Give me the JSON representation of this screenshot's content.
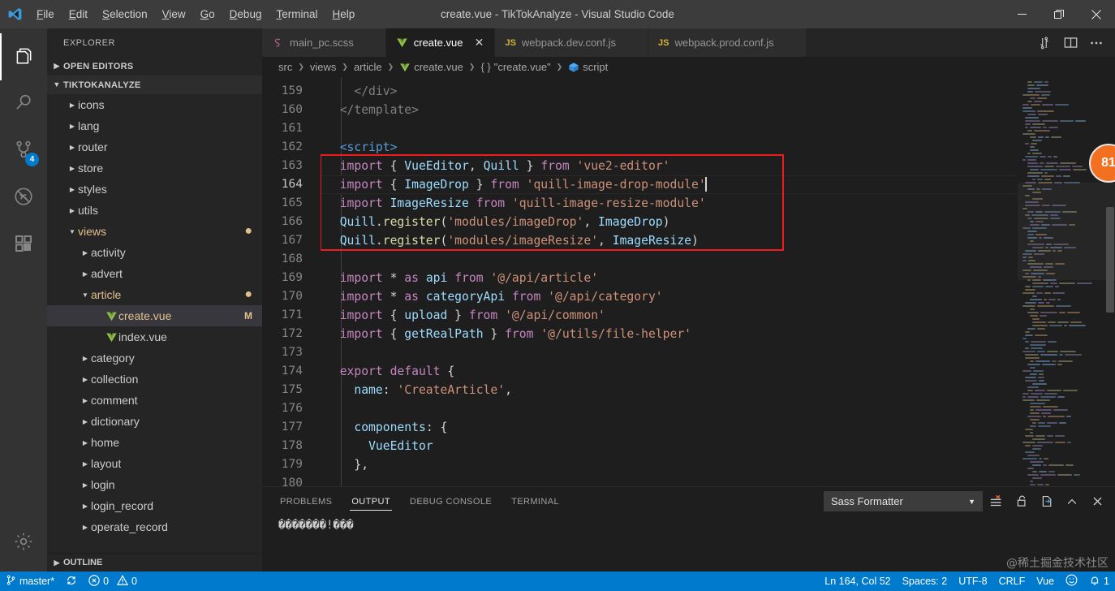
{
  "window": {
    "title": "create.vue - TikTokAnalyze - Visual Studio Code",
    "minimize": "–",
    "maximize": "❐",
    "close": "✕"
  },
  "menubar": {
    "items": [
      {
        "label": "File"
      },
      {
        "label": "Edit"
      },
      {
        "label": "Selection"
      },
      {
        "label": "View"
      },
      {
        "label": "Go"
      },
      {
        "label": "Debug"
      },
      {
        "label": "Terminal"
      },
      {
        "label": "Help"
      }
    ]
  },
  "activitybar": {
    "items": [
      {
        "name": "explorer",
        "icon": "files-icon",
        "badge": ""
      },
      {
        "name": "search",
        "icon": "search-icon",
        "badge": ""
      },
      {
        "name": "source-control",
        "icon": "source-control-icon",
        "badge": "4"
      },
      {
        "name": "debug",
        "icon": "debug-icon",
        "badge": ""
      },
      {
        "name": "extensions",
        "icon": "extensions-icon",
        "badge": ""
      }
    ],
    "settings_icon": "gear-icon"
  },
  "sidebar": {
    "title": "EXPLORER",
    "open_editors": "OPEN EDITORS",
    "project": "TIKTOKANALYZE",
    "outline": "OUTLINE",
    "tree": [
      {
        "label": "icons",
        "indent": 1,
        "type": "folder",
        "state": "collapsed"
      },
      {
        "label": "lang",
        "indent": 1,
        "type": "folder",
        "state": "collapsed"
      },
      {
        "label": "router",
        "indent": 1,
        "type": "folder",
        "state": "collapsed"
      },
      {
        "label": "store",
        "indent": 1,
        "type": "folder",
        "state": "collapsed"
      },
      {
        "label": "styles",
        "indent": 1,
        "type": "folder",
        "state": "collapsed"
      },
      {
        "label": "utils",
        "indent": 1,
        "type": "folder",
        "state": "collapsed"
      },
      {
        "label": "views",
        "indent": 1,
        "type": "folder",
        "state": "expanded",
        "modified": true
      },
      {
        "label": "activity",
        "indent": 2,
        "type": "folder",
        "state": "collapsed"
      },
      {
        "label": "advert",
        "indent": 2,
        "type": "folder",
        "state": "collapsed"
      },
      {
        "label": "article",
        "indent": 2,
        "type": "folder",
        "state": "expanded",
        "modified": true
      },
      {
        "label": "create.vue",
        "indent": 3,
        "type": "vue",
        "state": "none",
        "selected": true,
        "modified": true,
        "badge": "M"
      },
      {
        "label": "index.vue",
        "indent": 3,
        "type": "vue",
        "state": "none"
      },
      {
        "label": "category",
        "indent": 2,
        "type": "folder",
        "state": "collapsed"
      },
      {
        "label": "collection",
        "indent": 2,
        "type": "folder",
        "state": "collapsed"
      },
      {
        "label": "comment",
        "indent": 2,
        "type": "folder",
        "state": "collapsed"
      },
      {
        "label": "dictionary",
        "indent": 2,
        "type": "folder",
        "state": "collapsed"
      },
      {
        "label": "home",
        "indent": 2,
        "type": "folder",
        "state": "collapsed"
      },
      {
        "label": "layout",
        "indent": 2,
        "type": "folder",
        "state": "collapsed"
      },
      {
        "label": "login",
        "indent": 2,
        "type": "folder",
        "state": "collapsed"
      },
      {
        "label": "login_record",
        "indent": 2,
        "type": "folder",
        "state": "collapsed"
      },
      {
        "label": "operate_record",
        "indent": 2,
        "type": "folder",
        "state": "collapsed"
      }
    ]
  },
  "tabs": [
    {
      "label": "main_pc.scss",
      "icon": "sass-icon",
      "active": false
    },
    {
      "label": "create.vue",
      "icon": "vue-icon",
      "active": true
    },
    {
      "label": "webpack.dev.conf.js",
      "icon": "js-icon",
      "active": false
    },
    {
      "label": "webpack.prod.conf.js",
      "icon": "js-icon",
      "active": false
    }
  ],
  "editor_actions": [
    {
      "name": "split-editor-vertical-icon",
      "glyph": "⇅"
    },
    {
      "name": "split-editor-icon",
      "glyph": "▥"
    },
    {
      "name": "more-actions-icon",
      "glyph": "⋯"
    }
  ],
  "breadcrumbs": [
    {
      "label": "src",
      "icon": ""
    },
    {
      "label": "views",
      "icon": ""
    },
    {
      "label": "article",
      "icon": ""
    },
    {
      "label": "create.vue",
      "icon": "vue-icon"
    },
    {
      "label": "\"create.vue\"",
      "icon": "braces-icon"
    },
    {
      "label": "script",
      "icon": "cube-icon"
    }
  ],
  "code": {
    "first_line": 159,
    "cursor_line": 164,
    "lines": [
      {
        "n": 159,
        "tokens": [
          {
            "t": "    ",
            "c": "k-pn"
          },
          {
            "t": "</div>",
            "c": "k-tagb"
          }
        ]
      },
      {
        "n": 160,
        "tokens": [
          {
            "t": "  ",
            "c": "k-pn"
          },
          {
            "t": "</template>",
            "c": "k-tagb"
          }
        ]
      },
      {
        "n": 161,
        "tokens": []
      },
      {
        "n": 162,
        "tokens": [
          {
            "t": "  ",
            "c": "k-pn"
          },
          {
            "t": "<script>",
            "c": "k-tag"
          }
        ]
      },
      {
        "n": 163,
        "tokens": [
          {
            "t": "  ",
            "c": "k-pn"
          },
          {
            "t": "import",
            "c": "k-imp"
          },
          {
            "t": " { ",
            "c": "k-pn"
          },
          {
            "t": "VueEditor",
            "c": "k-var"
          },
          {
            "t": ", ",
            "c": "k-pn"
          },
          {
            "t": "Quill",
            "c": "k-var"
          },
          {
            "t": " } ",
            "c": "k-pn"
          },
          {
            "t": "from",
            "c": "k-imp"
          },
          {
            "t": " ",
            "c": "k-pn"
          },
          {
            "t": "'vue2-editor'",
            "c": "k-str"
          }
        ]
      },
      {
        "n": 164,
        "tokens": [
          {
            "t": "  ",
            "c": "k-pn"
          },
          {
            "t": "import",
            "c": "k-imp"
          },
          {
            "t": " { ",
            "c": "k-pn"
          },
          {
            "t": "ImageDrop",
            "c": "k-var"
          },
          {
            "t": " } ",
            "c": "k-pn"
          },
          {
            "t": "from",
            "c": "k-imp"
          },
          {
            "t": " ",
            "c": "k-pn"
          },
          {
            "t": "'quill-image-drop-module'",
            "c": "k-str"
          }
        ],
        "cursor": true
      },
      {
        "n": 165,
        "tokens": [
          {
            "t": "  ",
            "c": "k-pn"
          },
          {
            "t": "import",
            "c": "k-imp"
          },
          {
            "t": " ",
            "c": "k-pn"
          },
          {
            "t": "ImageResize",
            "c": "k-var"
          },
          {
            "t": " ",
            "c": "k-pn"
          },
          {
            "t": "from",
            "c": "k-imp"
          },
          {
            "t": " ",
            "c": "k-pn"
          },
          {
            "t": "'quill-image-resize-module'",
            "c": "k-str"
          }
        ]
      },
      {
        "n": 166,
        "tokens": [
          {
            "t": "  ",
            "c": "k-pn"
          },
          {
            "t": "Quill",
            "c": "k-var"
          },
          {
            "t": ".",
            "c": "k-pn"
          },
          {
            "t": "register",
            "c": "k-fn"
          },
          {
            "t": "(",
            "c": "k-pn"
          },
          {
            "t": "'modules/imageDrop'",
            "c": "k-str"
          },
          {
            "t": ", ",
            "c": "k-pn"
          },
          {
            "t": "ImageDrop",
            "c": "k-var"
          },
          {
            "t": ")",
            "c": "k-pn"
          }
        ]
      },
      {
        "n": 167,
        "tokens": [
          {
            "t": "  ",
            "c": "k-pn"
          },
          {
            "t": "Quill",
            "c": "k-var"
          },
          {
            "t": ".",
            "c": "k-pn"
          },
          {
            "t": "register",
            "c": "k-fn"
          },
          {
            "t": "(",
            "c": "k-pn"
          },
          {
            "t": "'modules/imageResize'",
            "c": "k-str"
          },
          {
            "t": ", ",
            "c": "k-pn"
          },
          {
            "t": "ImageResize",
            "c": "k-var"
          },
          {
            "t": ")",
            "c": "k-pn"
          }
        ]
      },
      {
        "n": 168,
        "tokens": []
      },
      {
        "n": 169,
        "tokens": [
          {
            "t": "  ",
            "c": "k-pn"
          },
          {
            "t": "import",
            "c": "k-imp"
          },
          {
            "t": " ",
            "c": "k-pn"
          },
          {
            "t": "*",
            "c": "k-pn"
          },
          {
            "t": " ",
            "c": "k-pn"
          },
          {
            "t": "as",
            "c": "k-imp"
          },
          {
            "t": " ",
            "c": "k-pn"
          },
          {
            "t": "api",
            "c": "k-var"
          },
          {
            "t": " ",
            "c": "k-pn"
          },
          {
            "t": "from",
            "c": "k-imp"
          },
          {
            "t": " ",
            "c": "k-pn"
          },
          {
            "t": "'@/api/article'",
            "c": "k-str"
          }
        ]
      },
      {
        "n": 170,
        "tokens": [
          {
            "t": "  ",
            "c": "k-pn"
          },
          {
            "t": "import",
            "c": "k-imp"
          },
          {
            "t": " ",
            "c": "k-pn"
          },
          {
            "t": "*",
            "c": "k-pn"
          },
          {
            "t": " ",
            "c": "k-pn"
          },
          {
            "t": "as",
            "c": "k-imp"
          },
          {
            "t": " ",
            "c": "k-pn"
          },
          {
            "t": "categoryApi",
            "c": "k-var"
          },
          {
            "t": " ",
            "c": "k-pn"
          },
          {
            "t": "from",
            "c": "k-imp"
          },
          {
            "t": " ",
            "c": "k-pn"
          },
          {
            "t": "'@/api/category'",
            "c": "k-str"
          }
        ]
      },
      {
        "n": 171,
        "tokens": [
          {
            "t": "  ",
            "c": "k-pn"
          },
          {
            "t": "import",
            "c": "k-imp"
          },
          {
            "t": " { ",
            "c": "k-pn"
          },
          {
            "t": "upload",
            "c": "k-var"
          },
          {
            "t": " } ",
            "c": "k-pn"
          },
          {
            "t": "from",
            "c": "k-imp"
          },
          {
            "t": " ",
            "c": "k-pn"
          },
          {
            "t": "'@/api/common'",
            "c": "k-str"
          }
        ]
      },
      {
        "n": 172,
        "tokens": [
          {
            "t": "  ",
            "c": "k-pn"
          },
          {
            "t": "import",
            "c": "k-imp"
          },
          {
            "t": " { ",
            "c": "k-pn"
          },
          {
            "t": "getRealPath",
            "c": "k-var"
          },
          {
            "t": " } ",
            "c": "k-pn"
          },
          {
            "t": "from",
            "c": "k-imp"
          },
          {
            "t": " ",
            "c": "k-pn"
          },
          {
            "t": "'@/utils/file-helper'",
            "c": "k-str"
          }
        ]
      },
      {
        "n": 173,
        "tokens": []
      },
      {
        "n": 174,
        "tokens": [
          {
            "t": "  ",
            "c": "k-pn"
          },
          {
            "t": "export",
            "c": "k-imp"
          },
          {
            "t": " ",
            "c": "k-pn"
          },
          {
            "t": "default",
            "c": "k-imp"
          },
          {
            "t": " {",
            "c": "k-pn"
          }
        ]
      },
      {
        "n": 175,
        "tokens": [
          {
            "t": "    ",
            "c": "k-pn"
          },
          {
            "t": "name",
            "c": "k-key"
          },
          {
            "t": ": ",
            "c": "k-pn"
          },
          {
            "t": "'CreateArticle'",
            "c": "k-str"
          },
          {
            "t": ",",
            "c": "k-pn"
          }
        ]
      },
      {
        "n": 176,
        "tokens": []
      },
      {
        "n": 177,
        "tokens": [
          {
            "t": "    ",
            "c": "k-pn"
          },
          {
            "t": "components",
            "c": "k-key"
          },
          {
            "t": ": {",
            "c": "k-pn"
          }
        ]
      },
      {
        "n": 178,
        "tokens": [
          {
            "t": "      ",
            "c": "k-pn"
          },
          {
            "t": "VueEditor",
            "c": "k-var"
          }
        ]
      },
      {
        "n": 179,
        "tokens": [
          {
            "t": "    ",
            "c": "k-pn"
          },
          {
            "t": "},",
            "c": "k-pn"
          }
        ]
      },
      {
        "n": 180,
        "tokens": []
      }
    ]
  },
  "overlay": {
    "badge_value": "81"
  },
  "panel": {
    "tabs": [
      {
        "label": "PROBLEMS",
        "active": false
      },
      {
        "label": "OUTPUT",
        "active": true
      },
      {
        "label": "DEBUG CONSOLE",
        "active": false
      },
      {
        "label": "TERMINAL",
        "active": false
      }
    ],
    "channel": "Sass Formatter",
    "channel_caret": "▼",
    "tools": [
      {
        "name": "clear-output-icon",
        "glyph": "clear"
      },
      {
        "name": "lock-scroll-icon",
        "glyph": "lock"
      },
      {
        "name": "open-in-editor-icon",
        "glyph": "open"
      },
      {
        "name": "maximize-panel-icon",
        "glyph": "^"
      },
      {
        "name": "close-panel-icon",
        "glyph": "✕"
      }
    ],
    "output_text": "�������!���"
  },
  "statusbar": {
    "branch": "master*",
    "sync_icon": "sync-icon",
    "errors": "0",
    "warnings": "0",
    "position": "Ln 164, Col 52",
    "indent": "Spaces: 2",
    "encoding": "UTF-8",
    "eol": "CRLF",
    "language": "Vue",
    "feedback_icon": "smiley-icon",
    "notifications": "1"
  },
  "watermark": "@稀土掘金技术社区",
  "colors": {
    "accent": "#007acc",
    "modified": "#e2c08d",
    "highlight_box": "#f21b1b",
    "badge_orange": "#f37021"
  }
}
